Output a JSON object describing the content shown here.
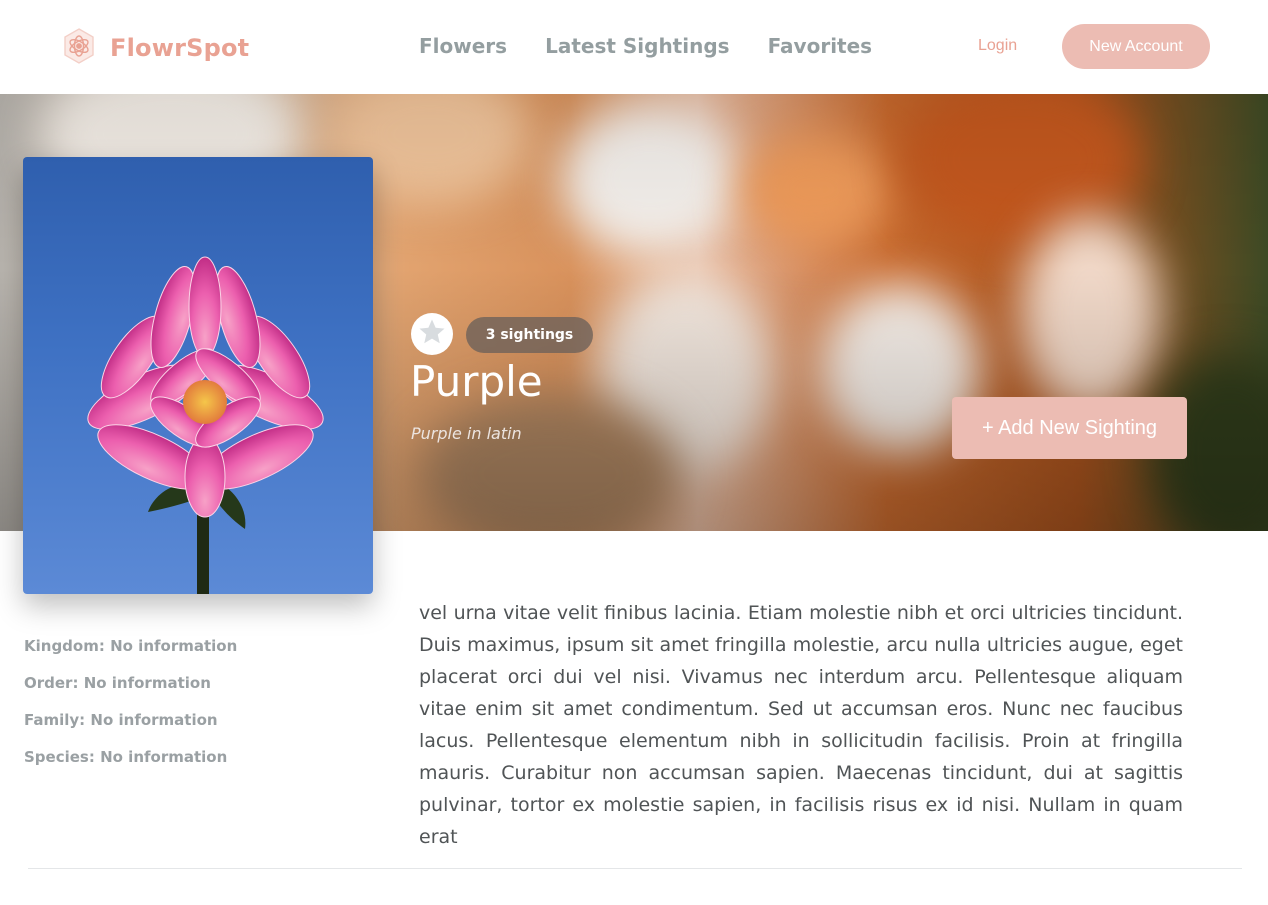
{
  "brand": {
    "name": "FlowrSpot",
    "color": "#e9a293"
  },
  "nav": {
    "items": [
      {
        "label": "Flowers"
      },
      {
        "label": "Latest Sightings"
      },
      {
        "label": "Favorites"
      }
    ],
    "login_label": "Login",
    "new_account_label": "New Account"
  },
  "flower": {
    "name": "Purple",
    "latin_name": "Purple in latin",
    "sightings_label": "3 sightings",
    "add_sighting_label": "+ Add New Sighting",
    "favorite_icon": "star-icon",
    "details": [
      {
        "label": "Kingdom:",
        "value": "No information"
      },
      {
        "label": "Order:",
        "value": "No information"
      },
      {
        "label": "Family:",
        "value": "No information"
      },
      {
        "label": "Species:",
        "value": "No information"
      }
    ],
    "description": "vel urna vitae velit finibus lacinia. Etiam molestie nibh et orci ultricies tincidunt. Duis maximus, ipsum sit amet fringilla molestie, arcu nulla ultricies augue, eget placerat orci dui vel nisi. Vivamus nec interdum arcu. Pellentesque aliquam vitae enim sit amet condimentum. Sed ut accumsan eros. Nunc nec faucibus lacus. Pellentesque elementum nibh in sollicitudin facilisis. Proin at fringilla mauris. Curabitur non accumsan sapien. Maecenas tincidunt, dui at sagittis pulvinar, tortor ex molestie sapien, in facilisis risus ex id nisi. Nullam in quam erat"
  },
  "colors": {
    "accent": "#ecbcb3",
    "nav_text": "#949ea0"
  }
}
